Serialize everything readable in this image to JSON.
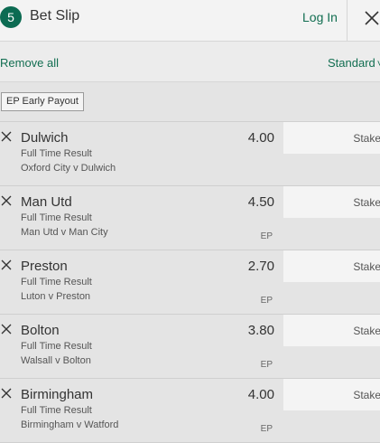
{
  "header": {
    "count": "5",
    "title": "Bet Slip",
    "login_label": "Log In"
  },
  "controls": {
    "remove_all_label": "Remove all",
    "standard_label": "Standard"
  },
  "filter": {
    "ep_badge_label": "EP Early Payout"
  },
  "selections": [
    {
      "team": "Dulwich",
      "market": "Full Time Result",
      "event": "Oxford City v Dulwich",
      "odds": "4.00",
      "ep": "",
      "stake_placeholder": "Stake"
    },
    {
      "team": "Man Utd",
      "market": "Full Time Result",
      "event": "Man Utd v Man City",
      "odds": "4.50",
      "ep": "EP",
      "stake_placeholder": "Stake"
    },
    {
      "team": "Preston",
      "market": "Full Time Result",
      "event": "Luton v Preston",
      "odds": "2.70",
      "ep": "EP",
      "stake_placeholder": "Stake"
    },
    {
      "team": "Bolton",
      "market": "Full Time Result",
      "event": "Walsall v Bolton",
      "odds": "3.80",
      "ep": "EP",
      "stake_placeholder": "Stake"
    },
    {
      "team": "Birmingham",
      "market": "Full Time Result",
      "event": "Birmingham v Watford",
      "odds": "4.00",
      "ep": "EP",
      "stake_placeholder": "Stake"
    }
  ],
  "colors": {
    "brand_green": "#0c6b52",
    "link_green": "#126e51",
    "background": "#e4e4e4",
    "stake_field": "#f4f4f4"
  },
  "icons": {
    "close": "close-icon",
    "remove_selection": "remove-selection-icon",
    "chevron": "chevron-down-icon"
  }
}
